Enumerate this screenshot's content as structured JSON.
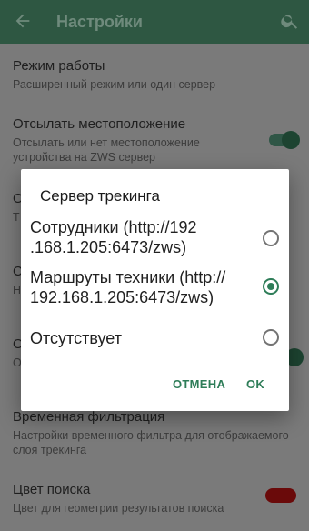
{
  "appbar": {
    "title": "Настройки",
    "back_icon": "arrow-left-icon",
    "search_icon": "search-icon"
  },
  "preferences": [
    {
      "title": "Режим работы",
      "summary": "Расширенный режим или один сервер"
    },
    {
      "title": "Отсылать местоположение",
      "summary": "Отсылать или нет местоположение устройства на ZWS сервер",
      "switch_on": true
    },
    {
      "title": "Временная фильтрация",
      "summary": "Настройки временного фильтра для отображаемого слоя трекинга"
    },
    {
      "title": "Цвет поиска",
      "summary": "Цвет для геометрии результатов поиска",
      "color": "#6a0a0a"
    }
  ],
  "background_fragments": [
    "О",
    "Т",
    "С",
    "Н",
    "О",
    "О"
  ],
  "dialog": {
    "title": "Сервер трекинга",
    "options": [
      {
        "label_line1": "Сотрудники (http://192",
        "label_line2": ".168.1.205:6473/zws)",
        "checked": false
      },
      {
        "label_line1": "Маршруты техники (http://",
        "label_line2": "192.168.1.205:6473/zws)",
        "checked": true
      },
      {
        "label_line1": "Отсутствует",
        "label_line2": "",
        "checked": false
      }
    ],
    "cancel_label": "ОТМЕНА",
    "ok_label": "OK"
  },
  "colors": {
    "accent": "#2e7d58",
    "appbar": "#2e5742"
  }
}
